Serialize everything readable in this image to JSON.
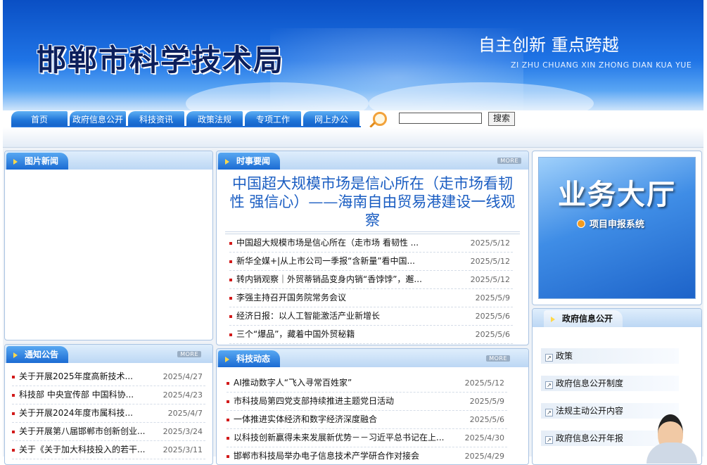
{
  "header": {
    "site_title": "邯郸市科学技术局",
    "slogan": "自主创新  重点跨越",
    "slogan_pinyin": "ZI ZHU CHUANG XIN ZHONG DIAN KUA YUE"
  },
  "nav": {
    "tabs": [
      "首页",
      "政府信息公开",
      "科技资讯",
      "政策法规",
      "专项工作",
      "网上办公"
    ],
    "search_placeholder": "",
    "search_button": "搜索"
  },
  "photo_news": {
    "title": "图片新闻"
  },
  "notices": {
    "title": "通知公告",
    "more": "MORE",
    "items": [
      {
        "title": "关于开展2025年度高新技术...",
        "date": "2025/4/27"
      },
      {
        "title": "科技部 中央宣传部 中国科协...",
        "date": "2025/4/23"
      },
      {
        "title": "关于开展2024年度市属科技...",
        "date": "2025/4/7"
      },
      {
        "title": "关于开展第八届邯郸市创新创业...",
        "date": "2025/3/24"
      },
      {
        "title": "关于《关于加大科技投入的若干...",
        "date": "2025/3/11"
      }
    ]
  },
  "current_affairs": {
    "title": "时事要闻",
    "more": "MORE",
    "headline": "中国超大规模市场是信心所在（走市场看韧性 强信心）——海南自由贸易港建设一线观察",
    "items": [
      {
        "title": "中国超大规模市场是信心所在（走市场 看韧性 ...",
        "date": "2025/5/12"
      },
      {
        "title": "新华全媒+|从上市公司一季报“含新量”看中国...",
        "date": "2025/5/12"
      },
      {
        "title": "转内销观察｜外贸蒂销品变身内销“香饽饽”，邂...",
        "date": "2025/5/12"
      },
      {
        "title": "李强主持召开国务院常务会议",
        "date": "2025/5/9"
      },
      {
        "title": "经济日报：以人工智能激活产业新增长",
        "date": "2025/5/6"
      },
      {
        "title": "三个“爆品”，藏着中国外贸秘籍",
        "date": "2025/5/6"
      }
    ]
  },
  "tech_news": {
    "title": "科技动态",
    "more": "MORE",
    "items": [
      {
        "title": "AI推动数字人“飞入寻常百姓家”",
        "date": "2025/5/12"
      },
      {
        "title": "市科技局第四党支部持续推进主题党日活动",
        "date": "2025/5/9"
      },
      {
        "title": "一体推进实体经济和数字经济深度融合",
        "date": "2025/5/6"
      },
      {
        "title": "以科技创新赢得未来发展新优势－－习近平总书记在上...",
        "date": "2025/4/30"
      },
      {
        "title": "邯郸市科技局举办电子信息技术产学研合作对接会",
        "date": "2025/4/29"
      }
    ]
  },
  "service_hall": {
    "title": "业务大厅",
    "link": "项目申报系统"
  },
  "gov_info": {
    "title": "政府信息公开",
    "items": [
      "政策",
      "政府信息公开制度",
      "法规主动公开内容",
      "政府信息公开年报"
    ]
  },
  "colors": {
    "brand_blue": "#1b6bd3",
    "headline_blue": "#1a5dc2",
    "bullet_red": "#d21a1a"
  }
}
